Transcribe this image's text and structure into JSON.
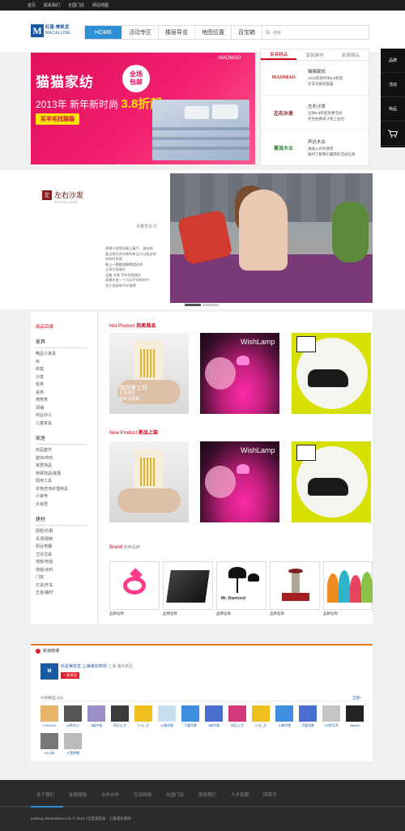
{
  "topbar": {
    "links": [
      "首页",
      "联系我们",
      "全国门店",
      "网站地图"
    ]
  },
  "logo": {
    "mark": "M",
    "cn": "红星·美凯龙",
    "en": "MACALLINE"
  },
  "nav": {
    "items": [
      "HOME",
      "活动专区",
      "楼层导览",
      "地图位置",
      "百宝箱"
    ],
    "search_placeholder": "搜索"
  },
  "right_sidebar": {
    "items": [
      "品牌",
      "活动",
      "特品"
    ]
  },
  "banner": {
    "brand": "MAOMAO",
    "title": "猫猫家纺",
    "badge_line1": "全场",
    "badge_line2": "包邮",
    "year_text": "2013年 新年新时尚",
    "discount": "3.8折起",
    "button": "买羊毛找猫猫"
  },
  "tabs": {
    "headers": [
      "家具精品",
      "家装建材",
      "家居精品"
    ],
    "rows": [
      {
        "logo": "MAOMAO",
        "name": "猫猫家纺",
        "line1": "2013年新时尚3.8折起",
        "line2": "买羊毛就找猫猫"
      },
      {
        "logo": "左右沙发",
        "name": "左右沙发",
        "line1": "全场6.8折起优惠活动",
        "line2": "买左右真皮沙发上左右"
      },
      {
        "logo": "蔓滋木业",
        "name": "声达木业",
        "line1": "填加入声达德宫",
        "line2": "随时了解我们最新的活动信息"
      }
    ]
  },
  "showcase": {
    "logo_cn": "左右沙发",
    "logo_en": "ZUOYOU SOFA",
    "quote": "青春宣言 红",
    "desc": [
      "青春人经常说着上着手，虽有跑",
      "要去建天名所感到幸运可以找自的",
      "时的时尚感",
      "脑上一颗翻滚翻腾遗进途",
      "立体三角表形",
      "设备 灵感 不同领地精灵",
      "青春外是一个与众不同的时代",
      "关于追尝有不好指得"
    ]
  },
  "categories": {
    "title": "商品目录",
    "groups": [
      {
        "name": "家具",
        "items": [
          "精品小家具",
          "床",
          "床垫",
          "沙发",
          "柜类",
          "桌类",
          "椅凳类",
          "洞铺",
          "商业办公",
          "儿童家具"
        ]
      },
      {
        "name": "家居",
        "items": [
          "床品套件",
          "窗帘/布料",
          "家居饰品",
          "特殊饰品/装置",
          "厨用工具",
          "衣物洗涤护理用具",
          "小家电",
          "大家居"
        ]
      },
      {
        "name": "建材",
        "items": [
          "厨柜/衣橱",
          "吊顶/隔断",
          "阳台电器",
          "卫浴洁具",
          "地板/地毯",
          "墙纸/涂料",
          "门窗",
          "灯具/开关",
          "五金/辅材"
        ]
      }
    ]
  },
  "hot": {
    "en": "Hot Product",
    "cn": "热卖商品",
    "p1_caption1": "瑞西里工坊",
    "p1_caption2": "生活调艺",
    "p1_caption3": "全系列促销",
    "wishlamp": "WishLamp"
  },
  "new": {
    "en": "New Product",
    "cn": "新品上架",
    "wishlamp": "WishLamp"
  },
  "brand": {
    "en": "Brand",
    "cn": "热卖品牌",
    "names": [
      "品牌名称",
      "品牌名称",
      "品牌名称",
      "品牌名称",
      "品牌名称"
    ],
    "mr_diamond": "Mr. Diamond"
  },
  "weibo": {
    "title": "新浪微博",
    "account_name": "红星美凯龙·上海浦东商场",
    "account_loc": "上海  浦东新区",
    "follow": "+ 加关注",
    "fans_label": "TA的粉丝 (11)",
    "all_label": "全部»",
    "fans_row1": [
      "ChiChiJu",
      "ju的办公",
      "3喵乎喵",
      "再见土方",
      "小元_大",
      "公寓伴狸",
      "可爱信野",
      "3喵乎喵",
      "再见土方",
      "小元_大",
      "公寓伴狸",
      "可爱信野",
      "V5挤沉浅",
      "biaoshi"
    ],
    "fans_row2": [
      "2012年",
      "大营梦雷"
    ]
  },
  "footer": {
    "links": [
      "关于我们",
      "友情链接",
      "合作伙伴",
      "互动商城",
      "全国门店",
      "联系我们",
      "人才招聘",
      "回首页"
    ],
    "copyright": "pudong.chinaredstar.com © 2013 | 红星美凯龙 · 上海浦东商场"
  }
}
